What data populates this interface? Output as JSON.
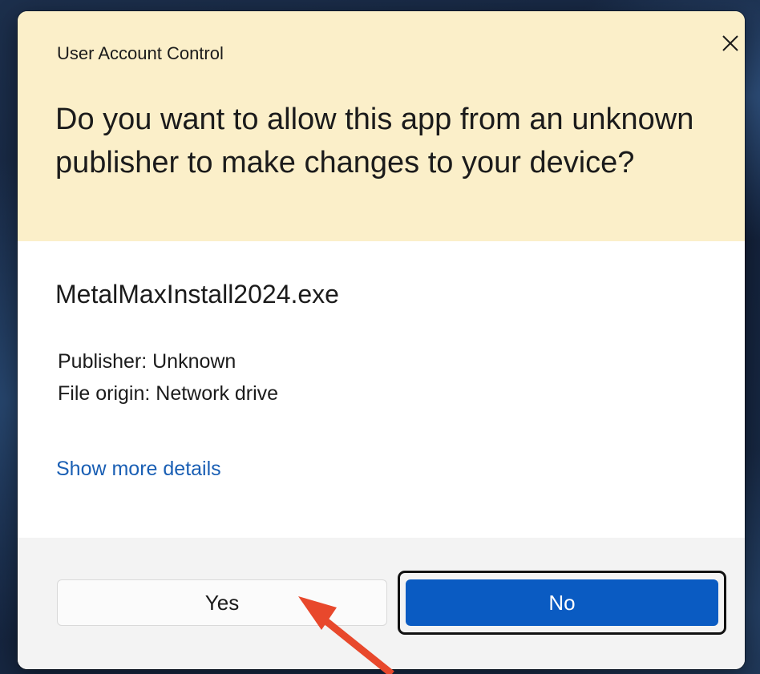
{
  "dialog": {
    "window_title": "User Account Control",
    "question": "Do you want to allow this app from an unknown publisher to make changes to your device?",
    "app_name": "MetalMaxInstall2024.exe",
    "publisher": "Publisher: Unknown",
    "file_origin": "File origin: Network drive",
    "details_link": "Show more details",
    "yes_label": "Yes",
    "no_label": "No",
    "close_icon": "close-icon"
  },
  "annotation": {
    "arrow_color": "#e8482c",
    "arrow_icon": "red-arrow-pointing-at-yes"
  },
  "colors": {
    "header_bg": "#fbefc9",
    "link": "#1a5fb4",
    "primary_button": "#0a5bc2"
  }
}
